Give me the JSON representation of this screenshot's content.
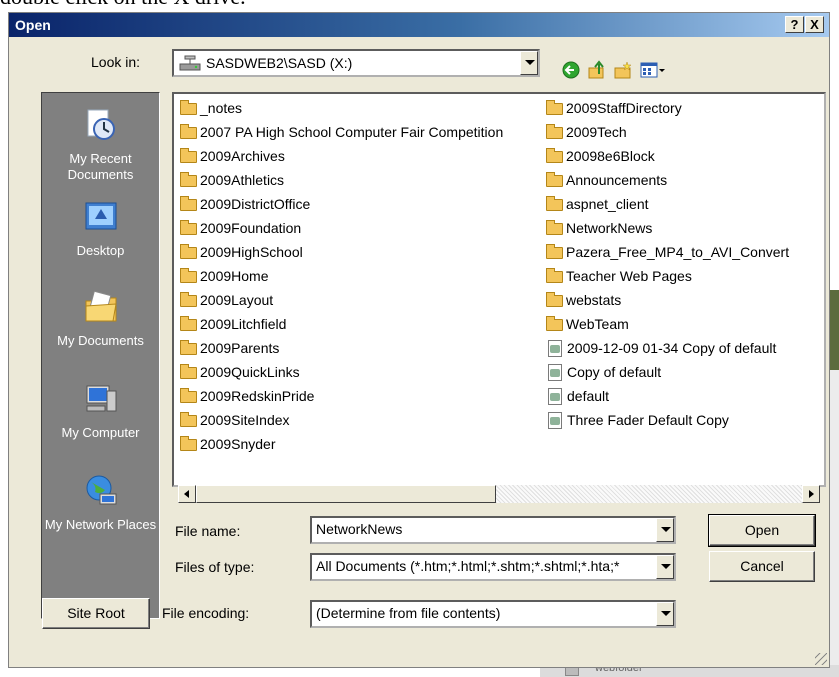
{
  "background": {
    "instruction_text": "double click on the X drive.",
    "behind_text": "webfolder"
  },
  "dialog": {
    "title": "Open",
    "help_label": "?",
    "close_label": "X",
    "look_in_label": "Look in:",
    "look_in_value": "SASDWEB2\\SASD (X:)",
    "nav_icons": [
      "back-icon",
      "up-folder-icon",
      "new-folder-icon",
      "view-menu-icon"
    ]
  },
  "places": [
    {
      "label": "My Recent Documents",
      "icon": "recent-documents-icon"
    },
    {
      "label": "Desktop",
      "icon": "desktop-icon"
    },
    {
      "label": "My Documents",
      "icon": "my-documents-icon"
    },
    {
      "label": "My Computer",
      "icon": "my-computer-icon"
    },
    {
      "label": "My Network Places",
      "icon": "network-places-icon"
    }
  ],
  "files": {
    "column1": [
      {
        "name": "_notes",
        "type": "folder"
      },
      {
        "name": "2007 PA High School Computer Fair Competition",
        "type": "folder"
      },
      {
        "name": "2009Archives",
        "type": "folder"
      },
      {
        "name": "2009Athletics",
        "type": "folder"
      },
      {
        "name": "2009DistrictOffice",
        "type": "folder"
      },
      {
        "name": "2009Foundation",
        "type": "folder"
      },
      {
        "name": "2009HighSchool",
        "type": "folder"
      },
      {
        "name": "2009Home",
        "type": "folder"
      },
      {
        "name": "2009Layout",
        "type": "folder"
      },
      {
        "name": "2009Litchfield",
        "type": "folder"
      },
      {
        "name": "2009Parents",
        "type": "folder"
      },
      {
        "name": "2009QuickLinks",
        "type": "folder"
      },
      {
        "name": "2009RedskinPride",
        "type": "folder"
      },
      {
        "name": "2009SiteIndex",
        "type": "folder"
      },
      {
        "name": "2009Snyder",
        "type": "folder"
      }
    ],
    "column2": [
      {
        "name": "2009StaffDirectory",
        "type": "folder"
      },
      {
        "name": "2009Tech",
        "type": "folder"
      },
      {
        "name": "20098e6Block",
        "type": "folder"
      },
      {
        "name": "Announcements",
        "type": "folder"
      },
      {
        "name": "aspnet_client",
        "type": "folder"
      },
      {
        "name": "NetworkNews",
        "type": "folder"
      },
      {
        "name": "Pazera_Free_MP4_to_AVI_Convert",
        "type": "folder"
      },
      {
        "name": "Teacher Web Pages",
        "type": "folder"
      },
      {
        "name": "webstats",
        "type": "folder"
      },
      {
        "name": "WebTeam",
        "type": "folder"
      },
      {
        "name": "2009-12-09 01-34 Copy of default",
        "type": "document"
      },
      {
        "name": "Copy of default",
        "type": "document"
      },
      {
        "name": "default",
        "type": "document"
      },
      {
        "name": "Three Fader Default Copy",
        "type": "document"
      }
    ]
  },
  "form": {
    "file_name_label": "File name:",
    "file_name_value": "NetworkNews",
    "files_of_type_label": "Files of type:",
    "files_of_type_value": "All Documents (*.htm;*.html;*.shtm;*.shtml;*.hta;*",
    "file_encoding_label": "File encoding:",
    "file_encoding_value": "(Determine from file contents)"
  },
  "buttons": {
    "open": "Open",
    "cancel": "Cancel",
    "site_root": "Site Root"
  }
}
